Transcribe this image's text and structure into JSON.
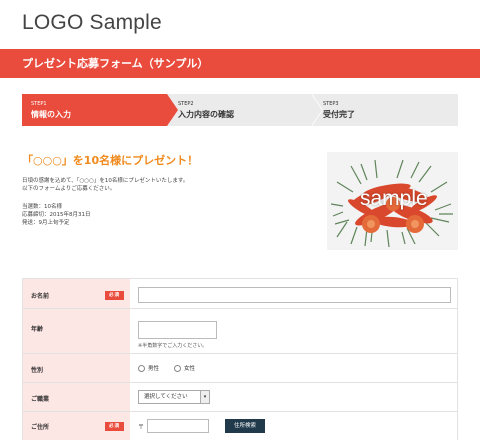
{
  "header": {
    "logo": "LOGO Sample"
  },
  "banner": {
    "title": "プレゼント応募フォーム（サンプル）"
  },
  "steps": [
    {
      "num": "STEP1",
      "label": "情報の入力",
      "active": true
    },
    {
      "num": "STEP2",
      "label": "入力内容の確認",
      "active": false
    },
    {
      "num": "STEP3",
      "label": "受付完了",
      "active": false
    }
  ],
  "campaign": {
    "headline": "「○○○」を10名様にプレゼント！",
    "intro_line1": "日頃の感謝を込めて、「○○○」を10名様にプレゼントいたします。",
    "intro_line2": "以下のフォームよりご応募ください。",
    "detail_winners": "当選数：10名様",
    "detail_deadline": "応募締切：2015年8月31日",
    "detail_shipping": "発送：9月上旬予定",
    "image_watermark": "sample"
  },
  "form": {
    "required_label": "必須",
    "name_label": "お名前",
    "age_label": "年齢",
    "age_note": "※半角数字でご入力ください。",
    "gender_label": "性別",
    "gender_options": [
      "男性",
      "女性"
    ],
    "job_label": "ご職業",
    "job_select_value": "選択してください",
    "address_label": "ご住所",
    "postal_mark": "〒",
    "address_search_button": "住所検索"
  },
  "colors": {
    "accent": "#e94b3c",
    "headline": "#f08a1c",
    "label_bg": "#fde7e5",
    "button": "#203a4c"
  }
}
